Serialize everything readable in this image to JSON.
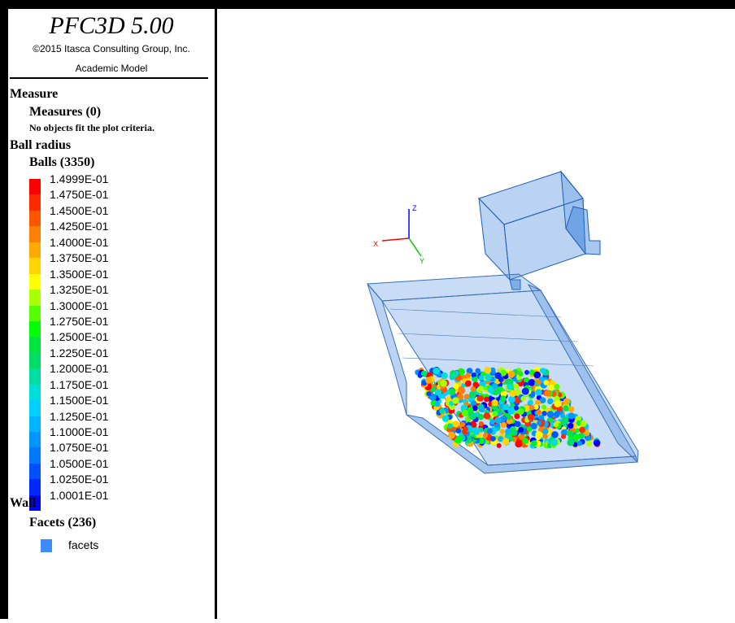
{
  "header": {
    "title": "PFC3D 5.00",
    "copyright": "©2015 Itasca Consulting Group, Inc.",
    "model": "Academic Model"
  },
  "legend": {
    "measure_heading": "Measure",
    "measures_label": "Measures (0)",
    "measures_note": "No objects fit the plot criteria.",
    "ball_heading": "Ball radius",
    "balls_label": "Balls (3350)",
    "scale_values": [
      "1.4999E-01",
      "1.4750E-01",
      "1.4500E-01",
      "1.4250E-01",
      "1.4000E-01",
      "1.3750E-01",
      "1.3500E-01",
      "1.3250E-01",
      "1.3000E-01",
      "1.2750E-01",
      "1.2500E-01",
      "1.2250E-01",
      "1.2000E-01",
      "1.1750E-01",
      "1.1500E-01",
      "1.1250E-01",
      "1.1000E-01",
      "1.0750E-01",
      "1.0500E-01",
      "1.0250E-01",
      "1.0001E-01"
    ],
    "scale_colors": [
      "#ff0000",
      "#ff2a00",
      "#ff5500",
      "#ff7f00",
      "#ffaa00",
      "#ffd400",
      "#ffff00",
      "#aaff00",
      "#55ff00",
      "#00ff00",
      "#00e640",
      "#00dd66",
      "#00dda0",
      "#00dddd",
      "#00d0ff",
      "#00b4ff",
      "#0096ff",
      "#0078ff",
      "#0050ff",
      "#0028ff",
      "#0000ff"
    ],
    "wall_heading": "Wall",
    "facets_label": "Facets (236)",
    "facets_item": "facets",
    "facets_color": "#3c8cff"
  },
  "axes": {
    "x_label": "X",
    "y_label": "Y",
    "z_label": "Z"
  }
}
